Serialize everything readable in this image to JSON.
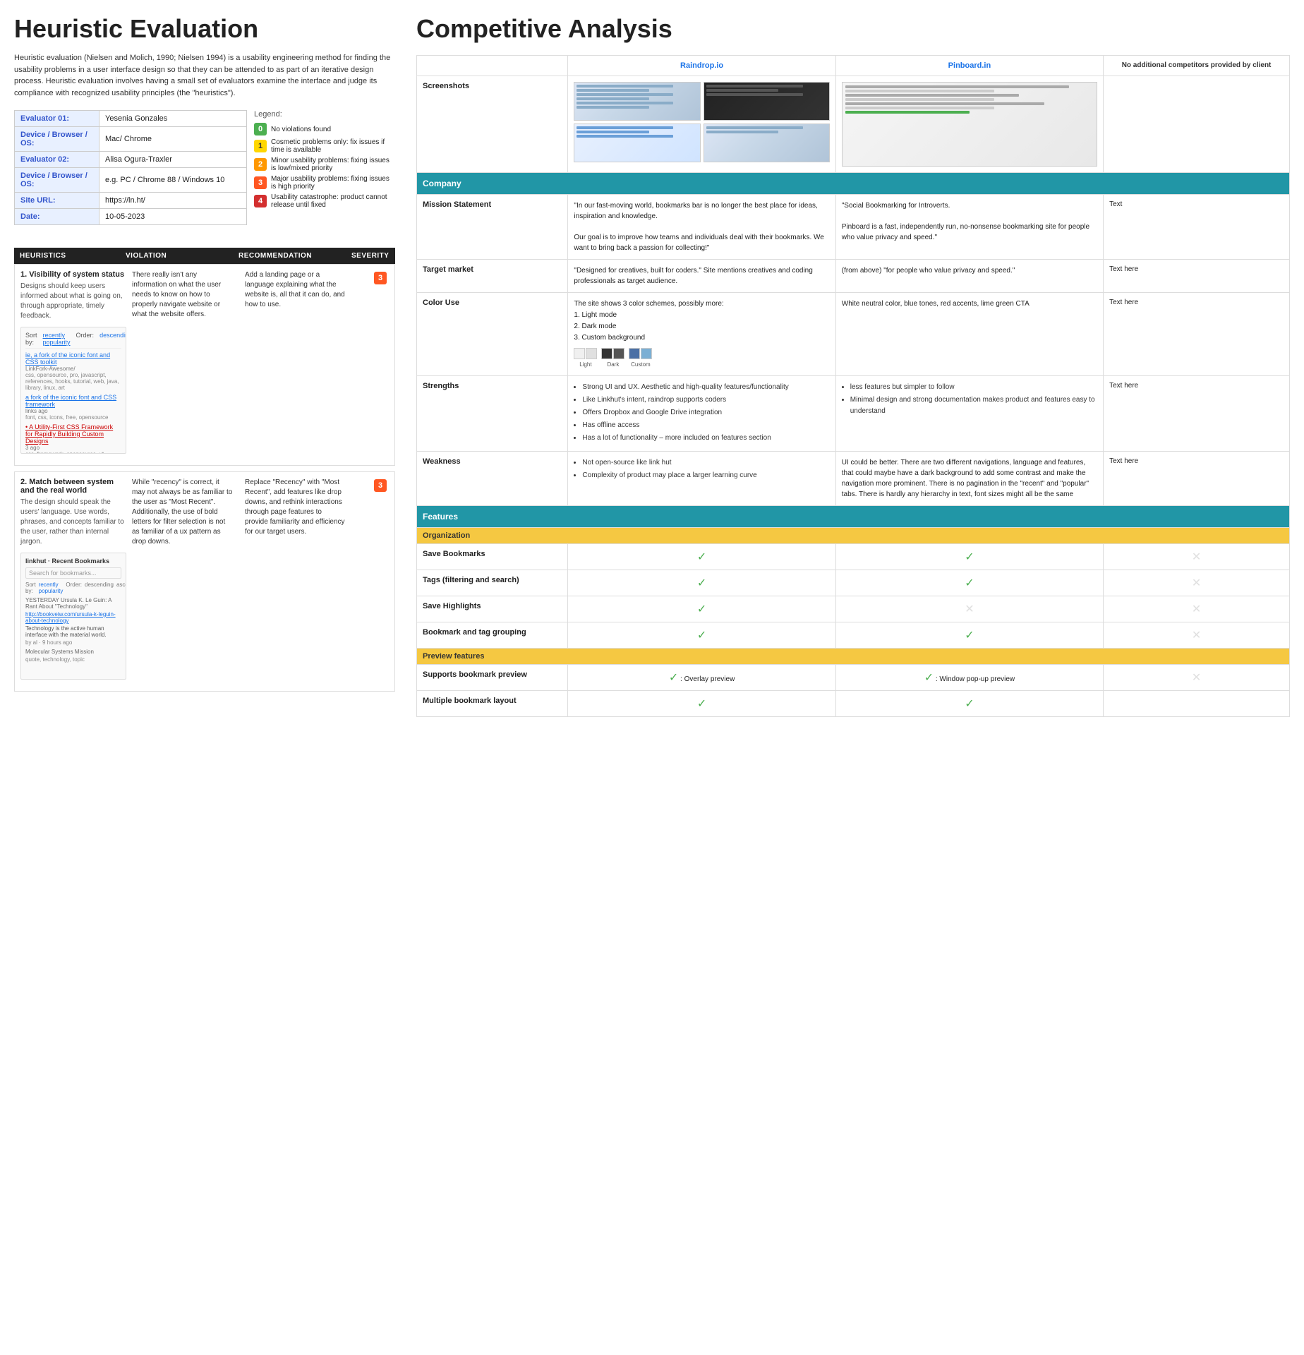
{
  "left": {
    "title": "Heuristic Evaluation",
    "intro": "Heuristic evaluation (Nielsen and Molich, 1990; Nielsen 1994) is a usability engineering method for finding the usability problems in a user interface design so that they can be attended to as part of an iterative design process. Heuristic evaluation involves having a small set of evaluators examine the interface and judge its compliance with recognized usability principles (the \"heuristics\").",
    "evaluators": [
      {
        "label": "Evaluator 01:",
        "value": "Yesenia Gonzales"
      },
      {
        "label": "Device / Browser / OS:",
        "value": "Mac/ Chrome"
      },
      {
        "label": "Evaluator 02:",
        "value": "Alisa Ogura-Traxler"
      },
      {
        "label": "Device / Browser / OS:",
        "value": "e.g. PC / Chrome 88 / Windows 10"
      },
      {
        "label": "Site URL:",
        "value": "https://ln.ht/"
      },
      {
        "label": "Date:",
        "value": "10-05-2023"
      }
    ],
    "legend": {
      "title": "Legend:",
      "items": [
        {
          "badge": "0",
          "class": "badge-0",
          "text": "No violations found"
        },
        {
          "badge": "1",
          "class": "badge-1",
          "text": "Cosmetic problems only: fix issues if time is available"
        },
        {
          "badge": "2",
          "class": "badge-2",
          "text": "Minor usability problems: fixing issues is low/mixed priority"
        },
        {
          "badge": "3",
          "class": "badge-3",
          "text": "Major usability problems: fixing issues is high priority"
        },
        {
          "badge": "4",
          "class": "badge-4",
          "text": "Usability catastrophe: product cannot release until fixed"
        }
      ]
    },
    "table_headers": [
      "HEURISTICS",
      "VIOLATION",
      "RECOMMENDATION",
      "SEVERITY"
    ],
    "heuristics": [
      {
        "title": "1. Visibility of system status",
        "desc": "Designs should keep users informed about what is going on, through appropriate, timely feedback.",
        "violation": "There really isn't any information on what the user needs to know on how to properly navigate website or what the website offers.",
        "recommendation": "Add a landing page or a language explaining what the website is, all that it can do, and how to use.",
        "severity": "3",
        "severity_class": "badge-3"
      },
      {
        "title": "2. Match between system and the real world",
        "desc": "The design should speak the users' language. Use words, phrases, and concepts familiar to the user, rather than internal jargon.",
        "violation": "While \"recency\" is correct, it may not always be as familiar to the user as \"Most Recent\". Additionally, the use of bold letters for filter selection is not as familiar of a ux pattern as drop downs.",
        "recommendation": "Replace \"Recency\" with \"Most Recent\", add features like drop downs, and rethink interactions through page features to provide familiarity and efficiency for our target users.",
        "severity": "3",
        "severity_class": "badge-3"
      }
    ]
  },
  "right": {
    "title": "Competitive Analysis",
    "col_headers": [
      "",
      "Raindrop.io",
      "Pinboard.in",
      "No additional competitors provided by client"
    ],
    "rows": [
      {
        "type": "data",
        "label": "Screenshots",
        "raindrop": "screenshot",
        "pinboard": "screenshot",
        "extra": ""
      }
    ],
    "section_company": "Company",
    "company_rows": [
      {
        "label": "Mission Statement",
        "raindrop": "\"In our fast-moving world, bookmarks bar is no longer the best place for ideas, inspiration and knowledge.\n\nOur goal is to improve how teams and individuals deal with their bookmarks. We want to bring back a passion for collecting!\"",
        "pinboard": "\"Social Bookmarking for Introverts.\n\nPinboard is a fast, independently run, no-nonsense bookmarking site for people who value privacy and speed.\"",
        "extra": "Text"
      },
      {
        "label": "Target market",
        "raindrop": "\"Designed for creatives, built for coders.\" Site mentions creatives and coding professionals as target audience.",
        "pinboard": "(from above) \"for people who value privacy and speed.\"",
        "extra": "Text here"
      },
      {
        "label": "Color Use",
        "raindrop": "The site shows 3 color schemes, possibly more:\n1. Light mode\n2. Dark mode\n3. Custom background",
        "pinboard": "White neutral color, blue tones, red accents, lime green CTA",
        "extra": "Text here"
      },
      {
        "label": "Strengths",
        "raindrop_bullets": [
          "Strong UI and UX. Aesthetic and high-quality features/functionality",
          "Like Linkhut's intent, raindrop supports coders",
          "Offers Dropbox and Google Drive integration",
          "Has offline access",
          "Has a lot of functionality – more included on features section"
        ],
        "pinboard_bullets": [
          "less features but simpler to follow",
          "Minimal design and strong documentation makes product and features easy to understand"
        ],
        "extra": "Text here"
      },
      {
        "label": "Weakness",
        "raindrop_bullets": [
          "Not open-source like link hut",
          "Complexity of product may place a larger learning curve"
        ],
        "pinboard": "UI could be better. There are two different navigations, language and features, that could maybe have a dark background to add some contrast and make the navigation more prominent. There is no pagination in the \"recent\" and \"popular\" tabs. There is hardly any hierarchy in text, font sizes might all be the same",
        "extra": "Text here"
      }
    ],
    "section_features": "Features",
    "section_org": "Organization",
    "feature_rows": [
      {
        "label": "Save Bookmarks",
        "raindrop": "check",
        "pinboard": "check",
        "extra": "x"
      },
      {
        "label": "Tags (filtering and search)",
        "raindrop": "check",
        "pinboard": "check",
        "extra": "x"
      },
      {
        "label": "Save Highlights",
        "raindrop": "check",
        "pinboard": "x",
        "extra": "x"
      },
      {
        "label": "Bookmark and tag grouping",
        "raindrop": "check",
        "pinboard": "check",
        "extra": "x"
      }
    ],
    "section_preview": "Preview features",
    "preview_rows": [
      {
        "label": "Supports bookmark preview",
        "raindrop": "✓ : Overlay preview",
        "pinboard": "✓ : Window pop-up preview",
        "extra": "x"
      },
      {
        "label": "Multiple bookmark layout",
        "raindrop": "check",
        "pinboard": "check",
        "extra": ""
      }
    ]
  }
}
